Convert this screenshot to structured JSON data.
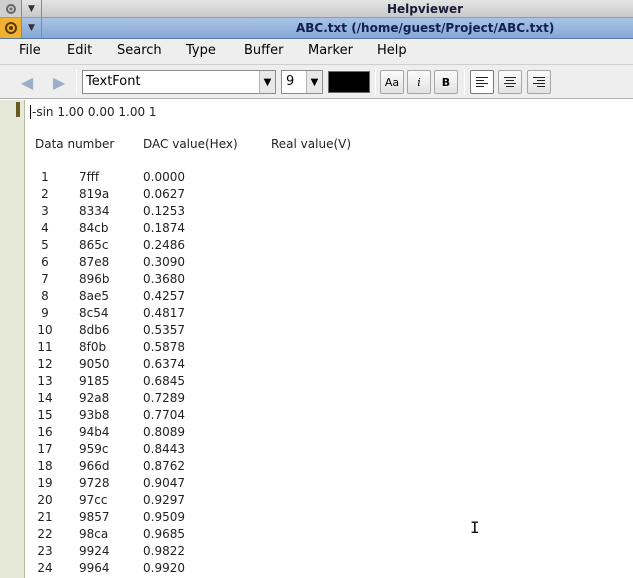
{
  "window": {
    "app_title": "Helpviewer",
    "doc_title": "ABC.txt   (/home/guest/Project/ABC.txt)"
  },
  "menu": [
    "File",
    "Edit",
    "Search",
    "Type",
    "Buffer",
    "Marker",
    "Help"
  ],
  "toolbar": {
    "font": "TextFont",
    "size": "9",
    "color": "#000000",
    "btn_aa": "Aa",
    "btn_italic": "i",
    "btn_bold": "B"
  },
  "editor": {
    "first_line": "-sin 1.00 0.00 1.00 1",
    "headers": [
      "Data number",
      "DAC value(Hex)",
      "Real value(V)"
    ],
    "rows": [
      [
        "1",
        "7fff",
        "0.0000"
      ],
      [
        "2",
        "819a",
        "0.0627"
      ],
      [
        "3",
        "8334",
        "0.1253"
      ],
      [
        "4",
        "84cb",
        "0.1874"
      ],
      [
        "5",
        "865c",
        "0.2486"
      ],
      [
        "6",
        "87e8",
        "0.3090"
      ],
      [
        "7",
        "896b",
        "0.3680"
      ],
      [
        "8",
        "8ae5",
        "0.4257"
      ],
      [
        "9",
        "8c54",
        "0.4817"
      ],
      [
        "10",
        "8db6",
        "0.5357"
      ],
      [
        "11",
        "8f0b",
        "0.5878"
      ],
      [
        "12",
        "9050",
        "0.6374"
      ],
      [
        "13",
        "9185",
        "0.6845"
      ],
      [
        "14",
        "92a8",
        "0.7289"
      ],
      [
        "15",
        "93b8",
        "0.7704"
      ],
      [
        "16",
        "94b4",
        "0.8089"
      ],
      [
        "17",
        "959c",
        "0.8443"
      ],
      [
        "18",
        "966d",
        "0.8762"
      ],
      [
        "19",
        "9728",
        "0.9047"
      ],
      [
        "20",
        "97cc",
        "0.9297"
      ],
      [
        "21",
        "9857",
        "0.9509"
      ],
      [
        "22",
        "98ca",
        "0.9685"
      ],
      [
        "23",
        "9924",
        "0.9822"
      ],
      [
        "24",
        "9964",
        "0.9920"
      ]
    ]
  }
}
